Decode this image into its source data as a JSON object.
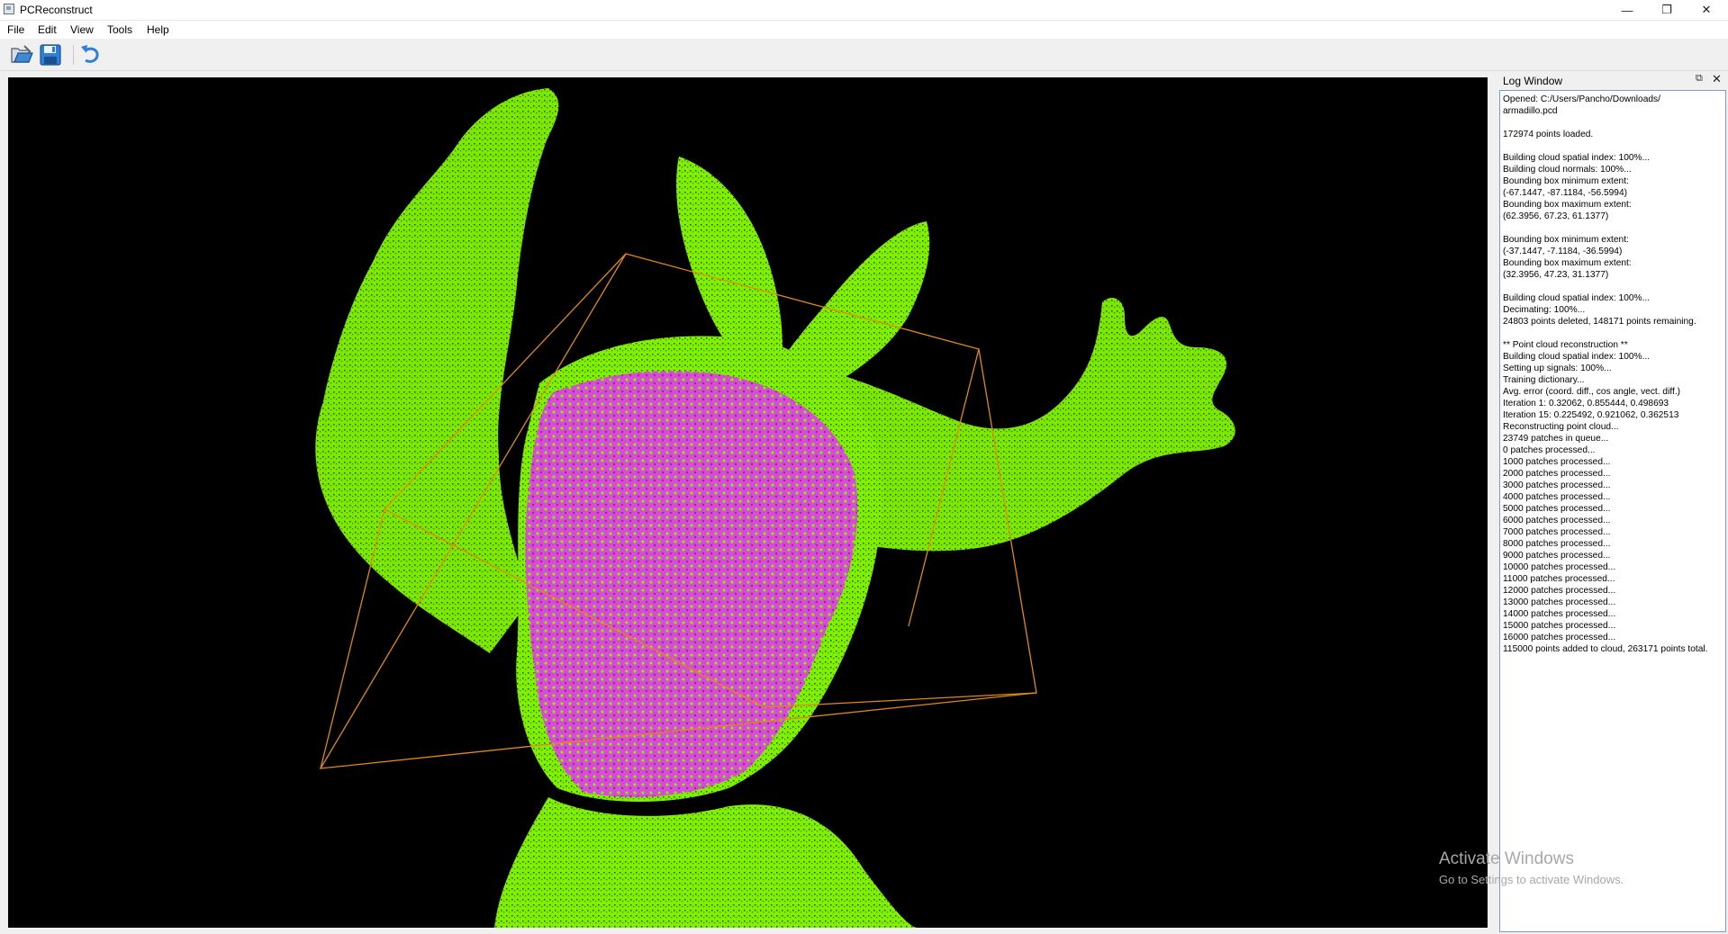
{
  "window": {
    "title": "PCReconstruct",
    "controls": {
      "minimize": "—",
      "maximize": "❐",
      "close": "✕"
    }
  },
  "menu": [
    {
      "label": "File"
    },
    {
      "label": "Edit"
    },
    {
      "label": "View"
    },
    {
      "label": "Tools"
    },
    {
      "label": "Help"
    }
  ],
  "toolbar": {
    "buttons": [
      {
        "icon": "open-icon"
      },
      {
        "icon": "save-icon"
      },
      {
        "icon": "undo-icon"
      }
    ]
  },
  "viewport": {
    "background": "#000000",
    "cloud_color": "#7ff000",
    "reconstructed_color": "#e040e8",
    "bbox_color": "#e08a10"
  },
  "log_window": {
    "title": "Log Window",
    "lines": [
      "Opened: C:/Users/Pancho/Downloads/",
      "armadillo.pcd",
      "",
      "172974 points loaded.",
      "",
      "Building cloud spatial index: 100%...",
      "Building cloud normals: 100%...",
      "Bounding box minimum extent:",
      "(-67.1447, -87.1184, -56.5994)",
      "Bounding box maximum extent:",
      "(62.3956, 67.23, 61.1377)",
      "",
      "Bounding box minimum extent:",
      "(-37.1447, -7.1184, -36.5994)",
      "Bounding box maximum extent:",
      "(32.3956, 47.23, 31.1377)",
      "",
      "Building cloud spatial index: 100%...",
      "Decimating: 100%...",
      "24803 points deleted, 148171 points remaining.",
      "",
      "** Point cloud reconstruction **",
      "Building cloud spatial index: 100%...",
      "Setting up signals: 100%...",
      "Training dictionary...",
      "Avg. error (coord. diff., cos angle, vect. diff.)",
      "Iteration 1: 0.32062, 0.855444, 0.498693",
      "Iteration 15: 0.225492, 0.921062, 0.362513",
      "Reconstructing point cloud...",
      "23749 patches in queue...",
      "0 patches processed...",
      "1000 patches processed...",
      "2000 patches processed...",
      "3000 patches processed...",
      "4000 patches processed...",
      "5000 patches processed...",
      "6000 patches processed...",
      "7000 patches processed...",
      "8000 patches processed...",
      "9000 patches processed...",
      "10000 patches processed...",
      "11000 patches processed...",
      "12000 patches processed...",
      "13000 patches processed...",
      "14000 patches processed...",
      "15000 patches processed...",
      "16000 patches processed...",
      "115000 points added to cloud, 263171 points total."
    ]
  },
  "watermark": {
    "title": "Activate Windows",
    "subtitle": "Go to Settings to activate Windows."
  }
}
